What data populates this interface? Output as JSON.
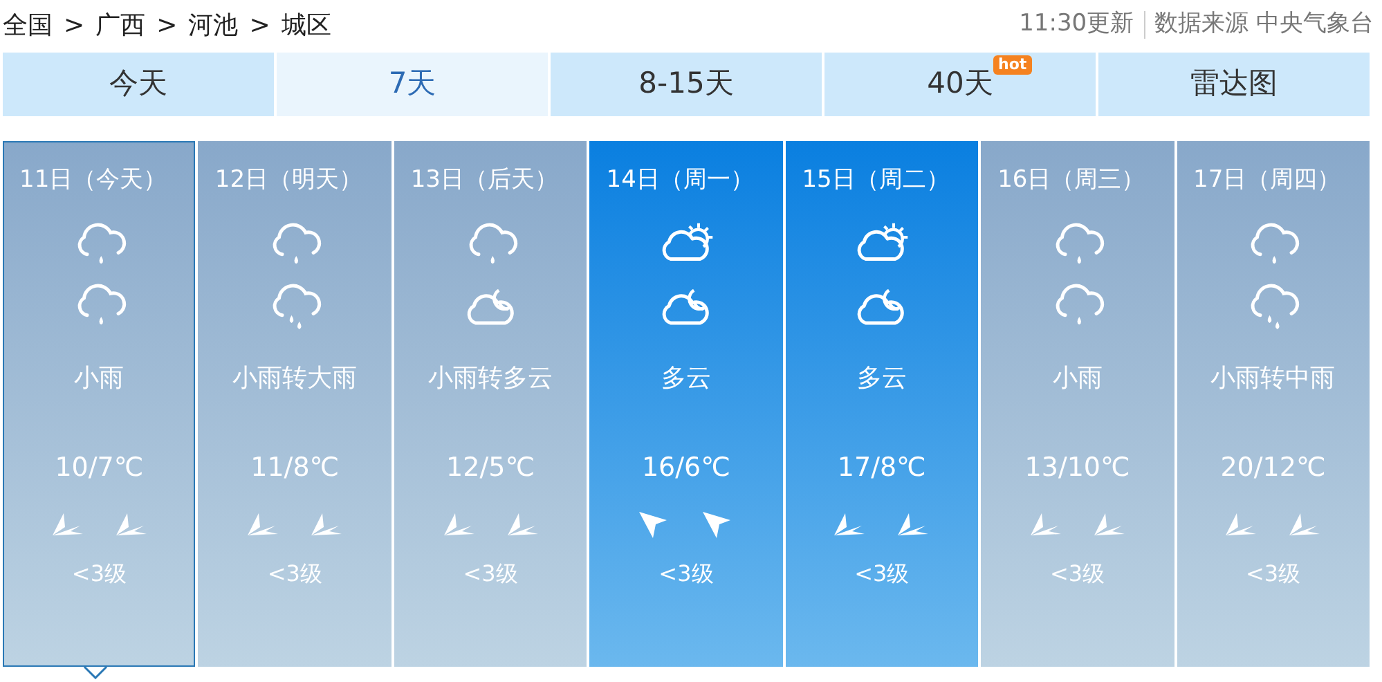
{
  "breadcrumb": [
    "全国",
    "广西",
    "河池",
    "城区"
  ],
  "breadcrumb_separator": ">",
  "update": {
    "time": "11:30更新",
    "source": "数据来源 中央气象台"
  },
  "tabs": [
    {
      "label": "今天",
      "selected": false
    },
    {
      "label": "7天",
      "selected": true
    },
    {
      "label": "8-15天",
      "selected": false
    },
    {
      "label": "40天",
      "selected": false,
      "badge": "hot"
    },
    {
      "label": "雷达图",
      "selected": false
    }
  ],
  "days": [
    {
      "date": "11日（今天）",
      "selected": true,
      "kind": "rainy",
      "icons": [
        {
          "kind": "rain"
        },
        {
          "kind": "rain"
        }
      ],
      "desc": "小雨",
      "temp": "10/7℃",
      "winds": [
        {
          "kind": "west"
        },
        {
          "kind": "west"
        }
      ],
      "level": "<3级"
    },
    {
      "date": "12日（明天）",
      "selected": false,
      "kind": "rainy",
      "icons": [
        {
          "kind": "rain"
        },
        {
          "kind": "heavyrain"
        }
      ],
      "desc": "小雨转大雨",
      "temp": "11/8℃",
      "winds": [
        {
          "kind": "west"
        },
        {
          "kind": "west"
        }
      ],
      "level": "<3级"
    },
    {
      "date": "13日（后天）",
      "selected": false,
      "kind": "rainy",
      "icons": [
        {
          "kind": "rain"
        },
        {
          "kind": "cloudnight"
        }
      ],
      "desc": "小雨转多云",
      "temp": "12/5℃",
      "winds": [
        {
          "kind": "west"
        },
        {
          "kind": "west"
        }
      ],
      "level": "<3级"
    },
    {
      "date": "14日（周一）",
      "selected": false,
      "kind": "clear",
      "icons": [
        {
          "kind": "cloudday"
        },
        {
          "kind": "cloudnight"
        }
      ],
      "desc": "多云",
      "temp": "16/6℃",
      "winds": [
        {
          "kind": "northwest"
        },
        {
          "kind": "northwest"
        }
      ],
      "level": "<3级"
    },
    {
      "date": "15日（周二）",
      "selected": false,
      "kind": "clear",
      "icons": [
        {
          "kind": "cloudday"
        },
        {
          "kind": "cloudnight"
        }
      ],
      "desc": "多云",
      "temp": "17/8℃",
      "winds": [
        {
          "kind": "west"
        },
        {
          "kind": "west"
        }
      ],
      "level": "<3级"
    },
    {
      "date": "16日（周三）",
      "selected": false,
      "kind": "rainy",
      "icons": [
        {
          "kind": "rain"
        },
        {
          "kind": "rain"
        }
      ],
      "desc": "小雨",
      "temp": "13/10℃",
      "winds": [
        {
          "kind": "west"
        },
        {
          "kind": "west"
        }
      ],
      "level": "<3级"
    },
    {
      "date": "17日（周四）",
      "selected": false,
      "kind": "rainy",
      "icons": [
        {
          "kind": "rain"
        },
        {
          "kind": "heavyrain"
        }
      ],
      "desc": "小雨转中雨",
      "temp": "20/12℃",
      "winds": [
        {
          "kind": "west"
        },
        {
          "kind": "west"
        }
      ],
      "level": "<3级"
    }
  ]
}
